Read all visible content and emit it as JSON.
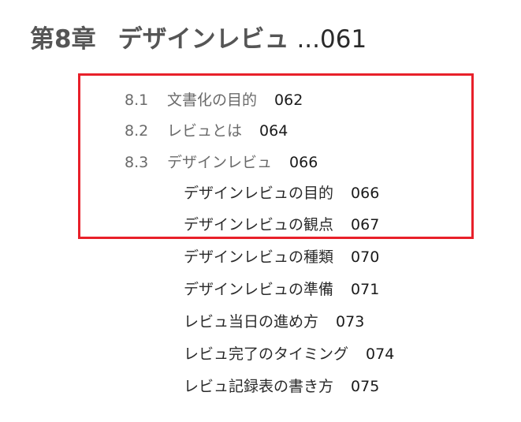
{
  "chapter": {
    "label": "第8章",
    "title": "デザインレビュ",
    "dots": "...",
    "page": "061"
  },
  "sections": [
    {
      "number": "8.1",
      "title": "文書化の目的",
      "page": "062"
    },
    {
      "number": "8.2",
      "title": "レビュとは",
      "page": "064"
    },
    {
      "number": "8.3",
      "title": "デザインレビュ",
      "page": "066"
    }
  ],
  "subsections": [
    {
      "title": "デザインレビュの目的",
      "page": "066"
    },
    {
      "title": "デザインレビュの観点",
      "page": "067"
    },
    {
      "title": "デザインレビュの種類",
      "page": "070"
    },
    {
      "title": "デザインレビュの準備",
      "page": "071"
    },
    {
      "title": "レビュ当日の進め方",
      "page": "073"
    },
    {
      "title": "レビュ完了のタイミング",
      "page": "074"
    },
    {
      "title": "レビュ記録表の書き方",
      "page": "075"
    }
  ],
  "highlight": {
    "color": "#e8202a"
  }
}
